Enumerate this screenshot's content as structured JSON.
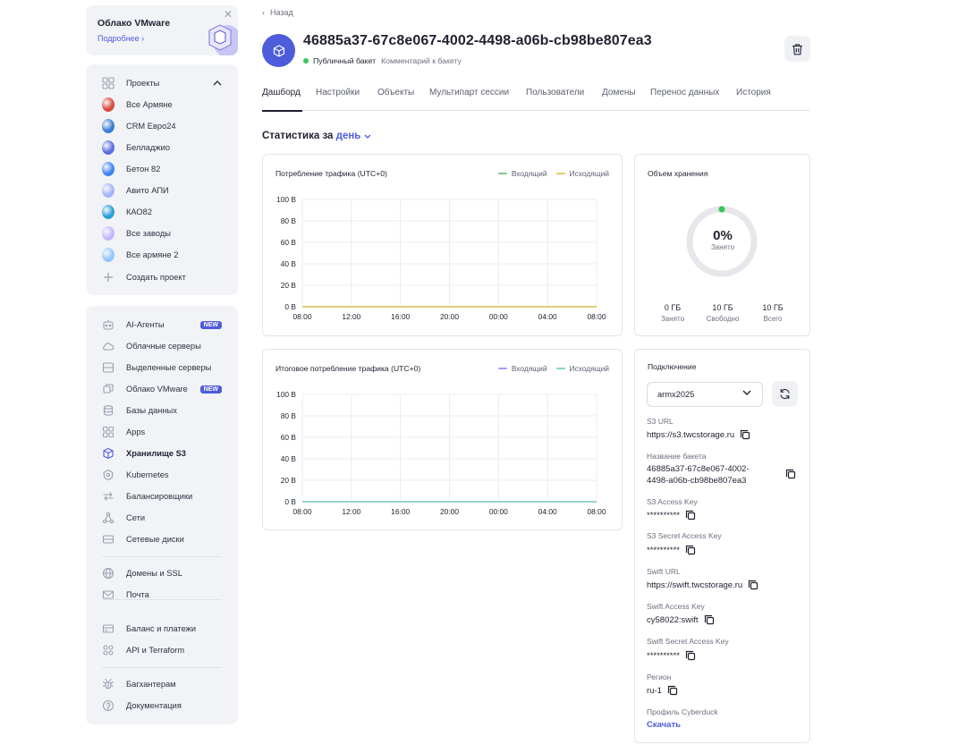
{
  "promo": {
    "title": "Облако VMware",
    "link": "Подробнее ›",
    "close": "✕"
  },
  "projects": {
    "header": "Проекты",
    "items": [
      {
        "label": "Все Армяне",
        "color": "#d94b3d"
      },
      {
        "label": "CRM Евро24",
        "color": "#3a7bd5"
      },
      {
        "label": "Белладжио",
        "color": "#5b6ee1"
      },
      {
        "label": "Бетон 82",
        "color": "#3b82f6"
      },
      {
        "label": "Авито АПИ",
        "color": "#a5b4fc"
      },
      {
        "label": "КАО82",
        "color": "#2a9dd8"
      },
      {
        "label": "Все заводы",
        "color": "#c4b5fd"
      },
      {
        "label": "Все армяне 2",
        "color": "#93c5fd"
      }
    ],
    "create": "Создать проект"
  },
  "services": {
    "items": [
      {
        "label": "AI-Агенты",
        "badge": "NEW",
        "icon": "robot-icon"
      },
      {
        "label": "Облачные серверы",
        "icon": "cloud-icon"
      },
      {
        "label": "Выделенные серверы",
        "icon": "server-icon"
      },
      {
        "label": "Облако VMware",
        "badge": "NEW",
        "icon": "vmware-icon"
      },
      {
        "label": "Базы данных",
        "icon": "database-icon"
      },
      {
        "label": "Apps",
        "icon": "apps-icon"
      },
      {
        "label": "Хранилище S3",
        "icon": "storage-icon",
        "active": true
      },
      {
        "label": "Kubernetes",
        "icon": "kubernetes-icon"
      },
      {
        "label": "Балансировщики",
        "icon": "balancer-icon"
      },
      {
        "label": "Сети",
        "icon": "network-icon"
      },
      {
        "label": "Сетевые диски",
        "icon": "disk-icon"
      }
    ],
    "group2": [
      {
        "label": "Домены и SSL",
        "icon": "globe-icon"
      },
      {
        "label": "Почта",
        "icon": "mail-icon"
      }
    ],
    "group3": [
      {
        "label": "Баланс и платежи",
        "icon": "card-icon"
      },
      {
        "label": "API и Terraform",
        "icon": "api-icon"
      }
    ],
    "group4": [
      {
        "label": "Багхантерам",
        "icon": "bug-icon"
      },
      {
        "label": "Документация",
        "icon": "help-icon"
      }
    ]
  },
  "header": {
    "back": "Назад",
    "title": "46885a37-67c8e067-4002-4498-a06b-cb98be807ea3",
    "status": "Публичный бакет",
    "comment": "Комментарий к бакету"
  },
  "tabs": [
    "Дашборд",
    "Настройки",
    "Объекты",
    "Мультипарт сессии",
    "Пользователи",
    "Домены",
    "Перенос данных",
    "История"
  ],
  "stats": {
    "prefix": "Статистика за",
    "period": "день"
  },
  "colors": {
    "accent": "#4d5cdb",
    "incoming_1": "#8bc48a",
    "outgoing_1": "#e6c760",
    "incoming_2": "#a99df0",
    "outgoing_2": "#7fd6c2"
  },
  "chart_data": [
    {
      "type": "line",
      "title": "Потребление трафика (UTC+0)",
      "x": [
        "08:00",
        "12:00",
        "16:00",
        "20:00",
        "00:00",
        "04:00",
        "08:00"
      ],
      "y_ticks": [
        "100 B",
        "80 B",
        "60 B",
        "40 B",
        "20 B",
        "0 B"
      ],
      "ylim": [
        0,
        100
      ],
      "series": [
        {
          "name": "Входящий",
          "values": [
            0,
            0,
            0,
            0,
            0,
            0,
            0
          ]
        },
        {
          "name": "Исходящий",
          "values": [
            0,
            0,
            0,
            0,
            0,
            0,
            0
          ]
        }
      ],
      "grid": true,
      "legend": "top-right"
    },
    {
      "type": "line",
      "title": "Итоговое потребление трафика (UTC+0)",
      "x": [
        "08:00",
        "12:00",
        "16:00",
        "20:00",
        "00:00",
        "04:00",
        "08:00"
      ],
      "y_ticks": [
        "100 B",
        "80 B",
        "60 B",
        "40 B",
        "20 B",
        "0 B"
      ],
      "ylim": [
        0,
        100
      ],
      "series": [
        {
          "name": "Входящий",
          "values": [
            0,
            0,
            0,
            0,
            0,
            0,
            0
          ]
        },
        {
          "name": "Исходящий",
          "values": [
            0,
            0,
            0,
            0,
            0,
            0,
            0
          ]
        }
      ],
      "grid": true,
      "legend": "top-right"
    }
  ],
  "storage": {
    "title": "Объем хранения",
    "percent": "0%",
    "percent_label": "Занято",
    "used_fraction": 0,
    "used": "0 ГБ",
    "used_label": "Занято",
    "free": "10 ГБ",
    "free_label": "Свободно",
    "total": "10 ГБ",
    "total_label": "Всего"
  },
  "connection": {
    "title": "Подключение",
    "selected_user": "armx2025",
    "fields": {
      "s3_url_label": "S3 URL",
      "s3_url": "https://s3.twcstorage.ru",
      "bucket_label": "Название бакета",
      "bucket_line1": "46885a37-67c8e067-4002-",
      "bucket_line2": "4498-a06b-cb98be807ea3",
      "s3_key_label": "S3 Access Key",
      "s3_key": "**********",
      "s3_secret_label": "S3 Secret Access Key",
      "s3_secret": "**********",
      "swift_url_label": "Swift URL",
      "swift_url": "https://swift.twcstorage.ru",
      "swift_key_label": "Swift Access Key",
      "swift_key": "cy58022:swift",
      "swift_secret_label": "Swift Secret Access Key",
      "swift_secret": "**********",
      "region_label": "Регион",
      "region": "ru-1",
      "cyberduck_label": "Профиль Cyberduck",
      "download": "Скачать"
    }
  }
}
